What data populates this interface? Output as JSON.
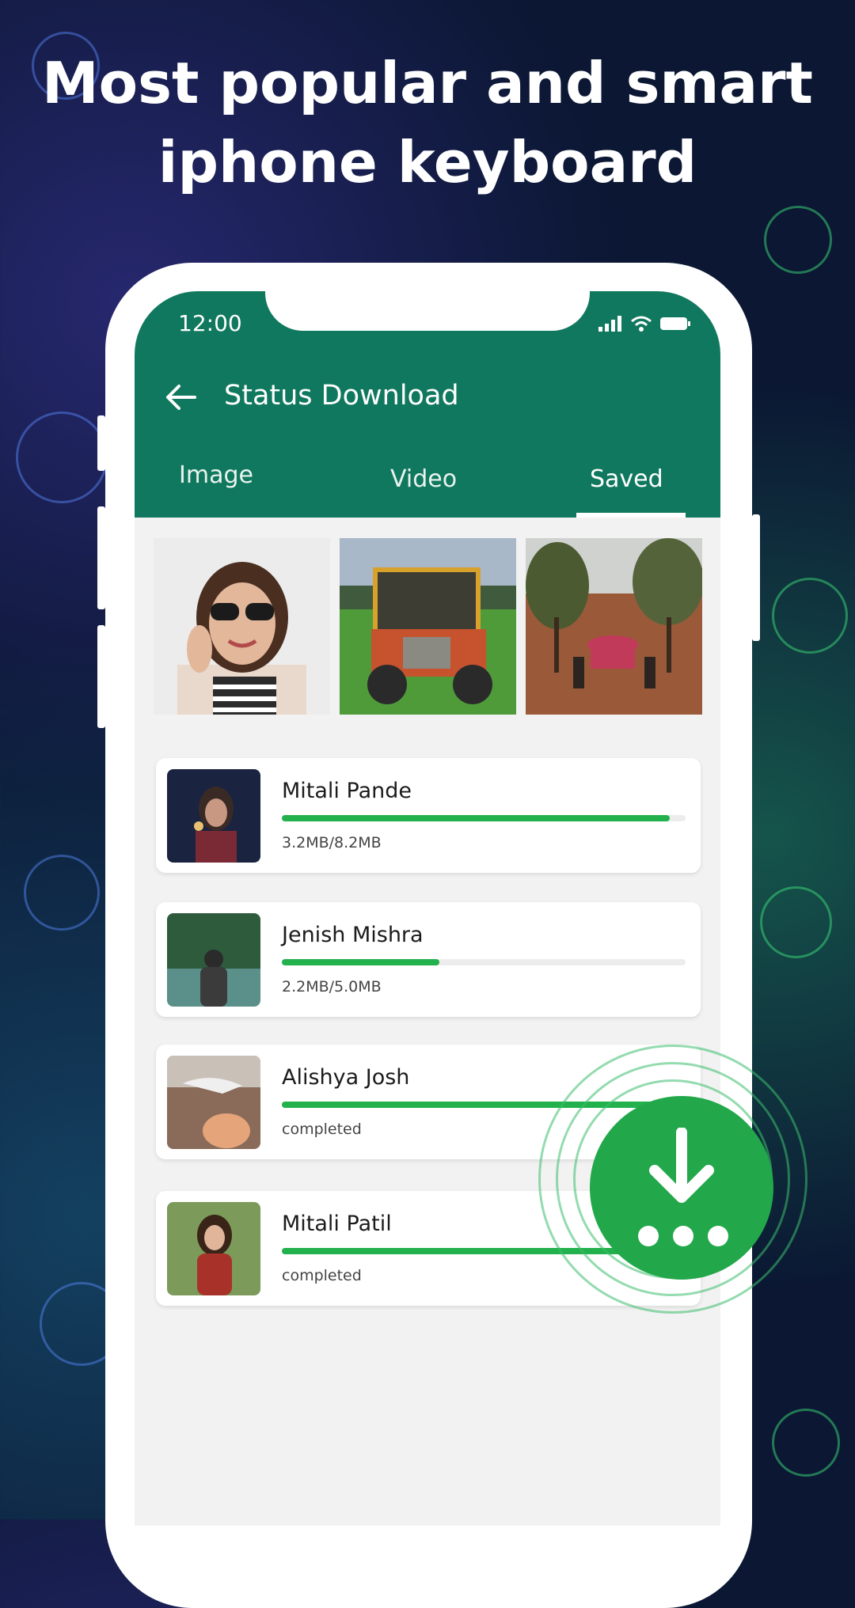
{
  "headline": {
    "line1": "Most popular and smart",
    "line2": "iphone keyboard"
  },
  "status_bar": {
    "time": "12:00"
  },
  "app_bar": {
    "title": "Status Download"
  },
  "tabs": [
    {
      "label": "Image"
    },
    {
      "label": "Video"
    },
    {
      "label": "Saved"
    }
  ],
  "active_tab": "Saved",
  "downloads": [
    {
      "name": "Mitali Pande",
      "size": "3.2MB/8.2MB",
      "progress": 0.96
    },
    {
      "name": "Jenish Mishra",
      "size": "2.2MB/5.0MB",
      "progress": 0.39
    },
    {
      "name": "Alishya Josh",
      "size": "completed",
      "progress": 1.0
    },
    {
      "name": "Mitali Patil",
      "size": "completed",
      "progress": 1.0
    }
  ],
  "colors": {
    "app_bar": "#10785e",
    "progress": "#22b14c",
    "fab": "#22a84a",
    "background": "#0b1733"
  }
}
